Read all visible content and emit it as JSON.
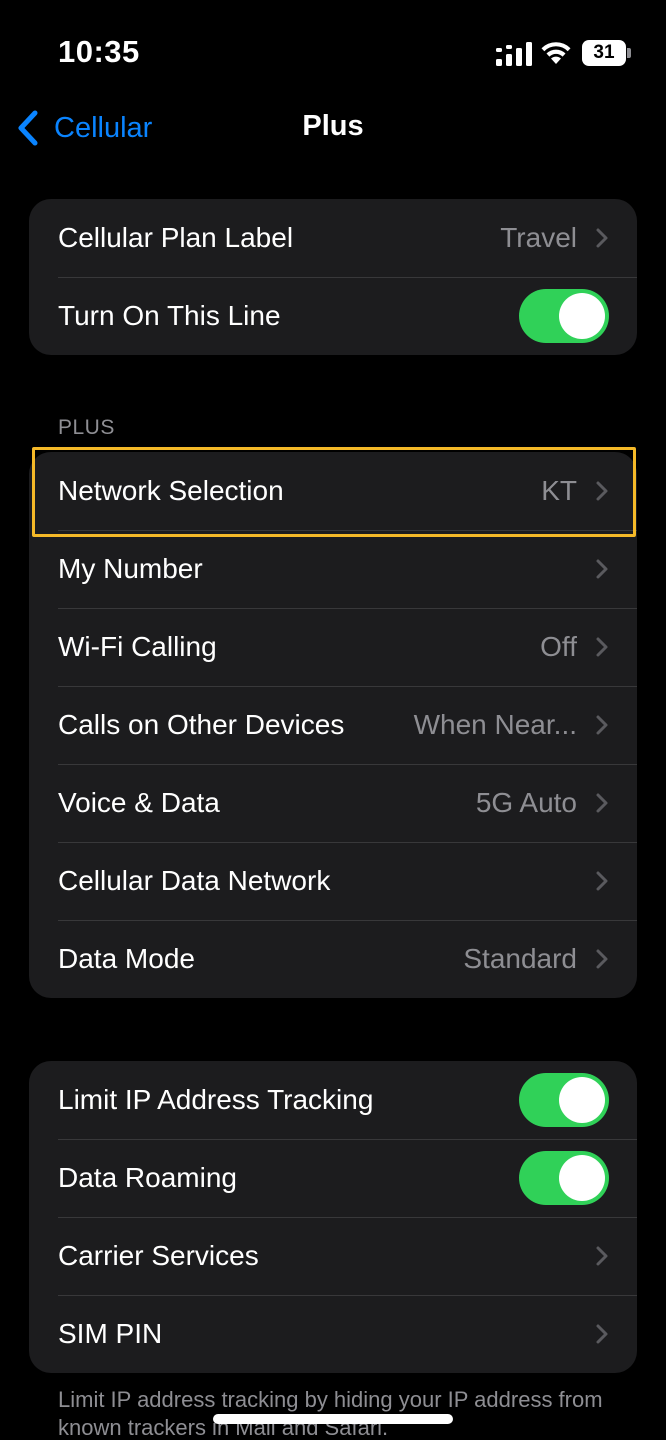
{
  "status_bar": {
    "time": "10:35",
    "battery": "31"
  },
  "nav": {
    "back_label": "Cellular",
    "title": "Plus"
  },
  "group1": {
    "rows": [
      {
        "label": "Cellular Plan Label",
        "value": "Travel"
      },
      {
        "label": "Turn On This Line",
        "toggle": true
      }
    ]
  },
  "section": {
    "header": "PLUS"
  },
  "group2": {
    "rows": [
      {
        "label": "Network Selection",
        "value": "KT"
      },
      {
        "label": "My Number",
        "value": ""
      },
      {
        "label": "Wi-Fi Calling",
        "value": "Off"
      },
      {
        "label": "Calls on Other Devices",
        "value": "When Near..."
      },
      {
        "label": "Voice & Data",
        "value": "5G Auto"
      },
      {
        "label": "Cellular Data Network",
        "value": ""
      },
      {
        "label": "Data Mode",
        "value": "Standard"
      }
    ]
  },
  "group3": {
    "rows": [
      {
        "label": "Limit IP Address Tracking",
        "toggle": true
      },
      {
        "label": "Data Roaming",
        "toggle": true
      },
      {
        "label": "Carrier Services",
        "value": ""
      },
      {
        "label": "SIM PIN",
        "value": ""
      }
    ]
  },
  "footer": {
    "note": "Limit IP address tracking by hiding your IP address from known trackers in Mail and Safari."
  },
  "colors": {
    "accent": "#0a84ff",
    "toggle_on": "#30d158",
    "highlight": "#f5b928"
  }
}
